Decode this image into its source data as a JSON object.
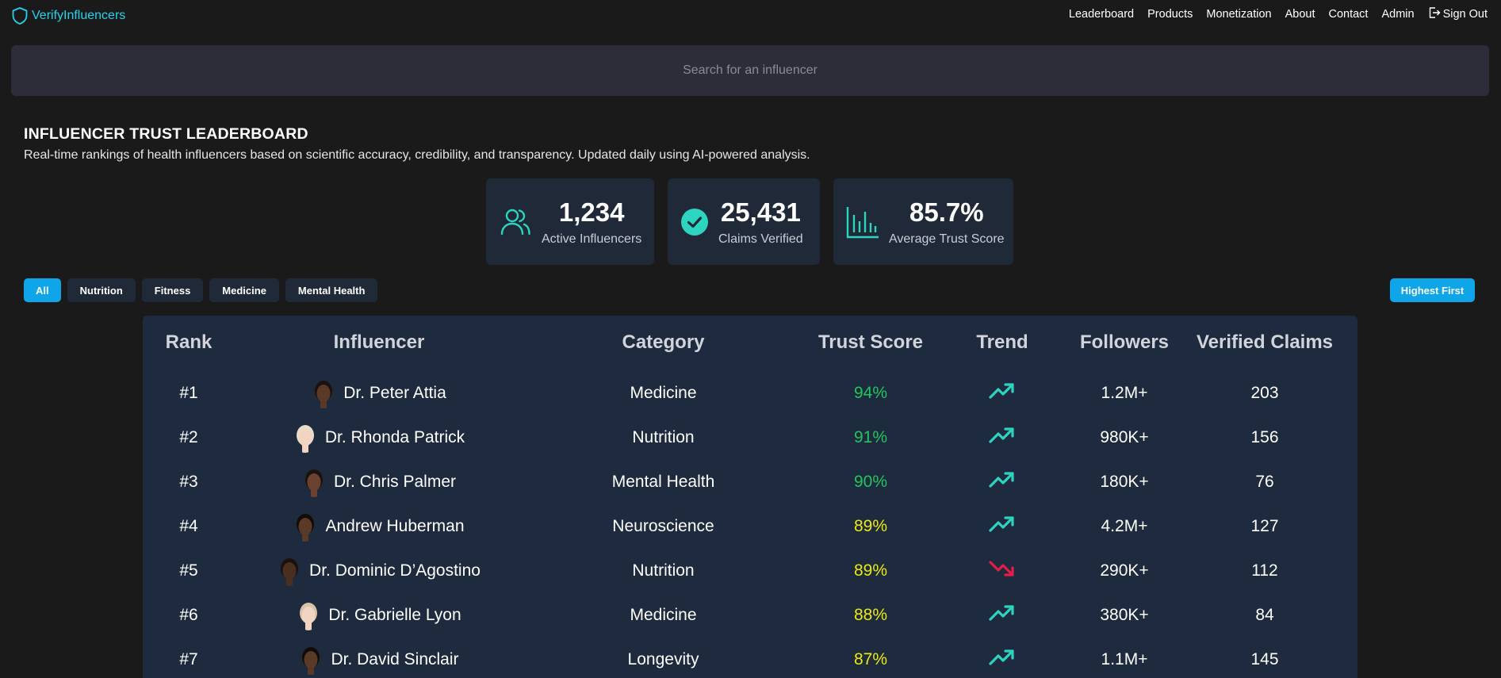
{
  "nav": {
    "brand": "VerifyInfluencers",
    "links": [
      "Leaderboard",
      "Products",
      "Monetization",
      "About",
      "Contact",
      "Admin"
    ],
    "signout": "Sign Out"
  },
  "search": {
    "placeholder": "Search for an influencer"
  },
  "header": {
    "title": "INFLUENCER TRUST LEADERBOARD",
    "subtitle": "Real-time rankings of health influencers based on scientific accuracy, credibility, and transparency. Updated daily using AI-powered analysis."
  },
  "stats": [
    {
      "value": "1,234",
      "label": "Active Influencers",
      "icon": "users-icon"
    },
    {
      "value": "25,431",
      "label": "Claims Verified",
      "icon": "check-circle-icon"
    },
    {
      "value": "85.7%",
      "label": "Average Trust Score",
      "icon": "bar-chart-icon"
    }
  ],
  "filters": [
    "All",
    "Nutrition",
    "Fitness",
    "Medicine",
    "Mental Health"
  ],
  "sort": {
    "label": "Highest First"
  },
  "table": {
    "headers": [
      "Rank",
      "Influencer",
      "Category",
      "Trust Score",
      "Trend",
      "Followers",
      "Verified Claims"
    ],
    "rows": [
      {
        "rank": "#1",
        "name": "Dr. Peter Attia",
        "category": "Medicine",
        "score": "94%",
        "trend": "up",
        "followers": "1.2M+",
        "claims": "203"
      },
      {
        "rank": "#2",
        "name": "Dr. Rhonda Patrick",
        "category": "Nutrition",
        "score": "91%",
        "trend": "up",
        "followers": "980K+",
        "claims": "156"
      },
      {
        "rank": "#3",
        "name": "Dr. Chris Palmer",
        "category": "Mental Health",
        "score": "90%",
        "trend": "up",
        "followers": "180K+",
        "claims": "76"
      },
      {
        "rank": "#4",
        "name": "Andrew Huberman",
        "category": "Neuroscience",
        "score": "89%",
        "trend": "up",
        "followers": "4.2M+",
        "claims": "127"
      },
      {
        "rank": "#5",
        "name": "Dr. Dominic D’Agostino",
        "category": "Nutrition",
        "score": "89%",
        "trend": "down",
        "followers": "290K+",
        "claims": "112"
      },
      {
        "rank": "#6",
        "name": "Dr. Gabrielle Lyon",
        "category": "Medicine",
        "score": "88%",
        "trend": "up",
        "followers": "380K+",
        "claims": "84"
      },
      {
        "rank": "#7",
        "name": "Dr. David Sinclair",
        "category": "Longevity",
        "score": "87%",
        "trend": "up",
        "followers": "1.1M+",
        "claims": "145"
      }
    ]
  },
  "colors": {
    "accent": "#0ea5e9",
    "brand": "#22d3ee",
    "teal": "#2dd4bf",
    "score_high": "#22c55e",
    "score_mid": "#eaea12",
    "trend_down": "#e11d48"
  }
}
